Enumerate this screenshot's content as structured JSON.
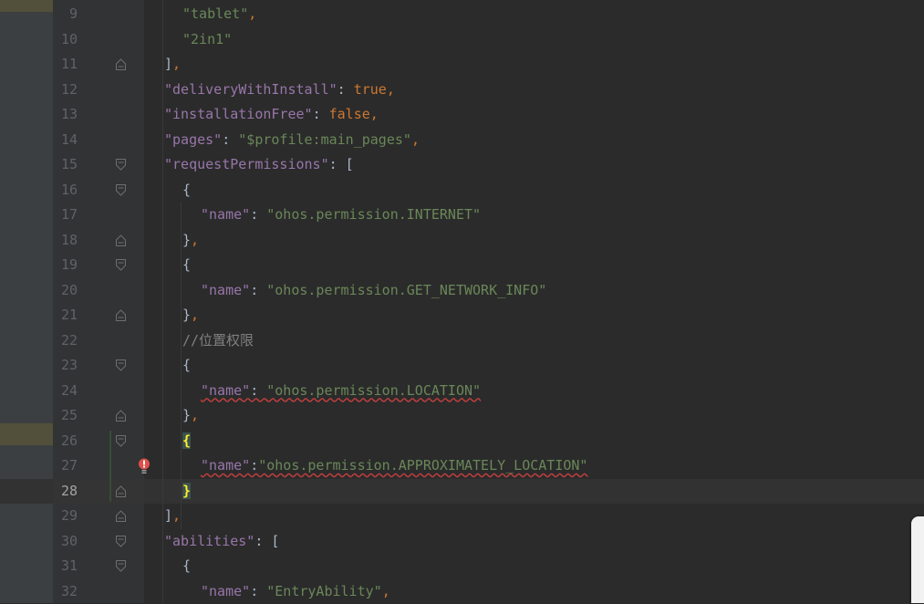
{
  "editor": {
    "language": "json5",
    "current_line": 28,
    "lines": [
      {
        "n": "9",
        "tokens": [
          {
            "t": "\"tablet\"",
            "c": "s"
          },
          {
            "t": ",",
            "c": "kw"
          }
        ]
      },
      {
        "n": "10",
        "tokens": [
          {
            "t": "\"2in1\"",
            "c": "s"
          }
        ]
      },
      {
        "n": "11",
        "tokens": [
          {
            "t": "]",
            "c": "p"
          },
          {
            "t": ",",
            "c": "kw"
          }
        ]
      },
      {
        "n": "12",
        "tokens": [
          {
            "t": "\"deliveryWithInstall\"",
            "c": "k"
          },
          {
            "t": ": ",
            "c": "p"
          },
          {
            "t": "true",
            "c": "kw"
          },
          {
            "t": ",",
            "c": "kw"
          }
        ]
      },
      {
        "n": "13",
        "tokens": [
          {
            "t": "\"installationFree\"",
            "c": "k"
          },
          {
            "t": ": ",
            "c": "p"
          },
          {
            "t": "false",
            "c": "kw"
          },
          {
            "t": ",",
            "c": "kw"
          }
        ]
      },
      {
        "n": "14",
        "tokens": [
          {
            "t": "\"pages\"",
            "c": "k"
          },
          {
            "t": ": ",
            "c": "p"
          },
          {
            "t": "\"$profile:main_pages\"",
            "c": "s"
          },
          {
            "t": ",",
            "c": "kw"
          }
        ]
      },
      {
        "n": "15",
        "tokens": [
          {
            "t": "\"requestPermissions\"",
            "c": "k"
          },
          {
            "t": ": [",
            "c": "p"
          }
        ]
      },
      {
        "n": "16",
        "tokens": [
          {
            "t": "{",
            "c": "p"
          }
        ]
      },
      {
        "n": "17",
        "tokens": [
          {
            "t": "\"name\"",
            "c": "k"
          },
          {
            "t": ": ",
            "c": "p"
          },
          {
            "t": "\"ohos.permission.INTERNET\"",
            "c": "s"
          }
        ]
      },
      {
        "n": "18",
        "tokens": [
          {
            "t": "}",
            "c": "p"
          },
          {
            "t": ",",
            "c": "kw"
          }
        ]
      },
      {
        "n": "19",
        "tokens": [
          {
            "t": "{",
            "c": "p"
          }
        ]
      },
      {
        "n": "20",
        "tokens": [
          {
            "t": "\"name\"",
            "c": "k"
          },
          {
            "t": ": ",
            "c": "p"
          },
          {
            "t": "\"ohos.permission.GET_NETWORK_INFO\"",
            "c": "s"
          }
        ]
      },
      {
        "n": "21",
        "tokens": [
          {
            "t": "}",
            "c": "p"
          },
          {
            "t": ",",
            "c": "kw"
          }
        ]
      },
      {
        "n": "22",
        "tokens": [
          {
            "t": "//位置权限",
            "c": "c"
          }
        ]
      },
      {
        "n": "23",
        "tokens": [
          {
            "t": "{",
            "c": "p"
          }
        ]
      },
      {
        "n": "24",
        "tokens": [
          {
            "t": "\"name\": \"ohos.permission.LOCATION\"",
            "c": "err-mix1"
          }
        ]
      },
      {
        "n": "25",
        "tokens": [
          {
            "t": "}",
            "c": "p"
          },
          {
            "t": ",",
            "c": "kw"
          }
        ]
      },
      {
        "n": "26",
        "tokens": [
          {
            "t": "{",
            "c": "brace"
          }
        ]
      },
      {
        "n": "27",
        "tokens": [
          {
            "t": "\"name\":\"ohos.permission.APPROXIMATELY_LOCATION\"",
            "c": "err-mix2"
          }
        ]
      },
      {
        "n": "28",
        "tokens": [
          {
            "t": "}",
            "c": "brace"
          }
        ]
      },
      {
        "n": "29",
        "tokens": [
          {
            "t": "]",
            "c": "p"
          },
          {
            "t": ",",
            "c": "kw"
          }
        ]
      },
      {
        "n": "30",
        "tokens": [
          {
            "t": "\"abilities\"",
            "c": "k"
          },
          {
            "t": ": [",
            "c": "p"
          }
        ]
      },
      {
        "n": "31",
        "tokens": [
          {
            "t": "{",
            "c": "p"
          }
        ]
      },
      {
        "n": "32",
        "tokens": [
          {
            "t": "\"name\"",
            "c": "k"
          },
          {
            "t": ": ",
            "c": "p"
          },
          {
            "t": "\"EntryAbility\"",
            "c": "s"
          },
          {
            "t": ",",
            "c": "kw"
          }
        ]
      }
    ],
    "error_line_24": {
      "key": "\"name\"",
      "sep": ": ",
      "value": "\"ohos.permission.LOCATION\""
    },
    "error_line_27": {
      "key": "\"name\"",
      "sep": ":",
      "value": "\"ohos.permission.APPROXIMATELY_LOCATION\""
    },
    "error_icon": "error-bulb-icon",
    "fold_icon": "fold-marker-icon",
    "colors": {
      "background": "#2b2b2b",
      "key": "#9876aa",
      "string": "#6a8759",
      "keyword": "#cc7832",
      "comment": "#808080",
      "brace_highlight": "#ffef28",
      "error_underline": "#bc3f3c"
    }
  }
}
